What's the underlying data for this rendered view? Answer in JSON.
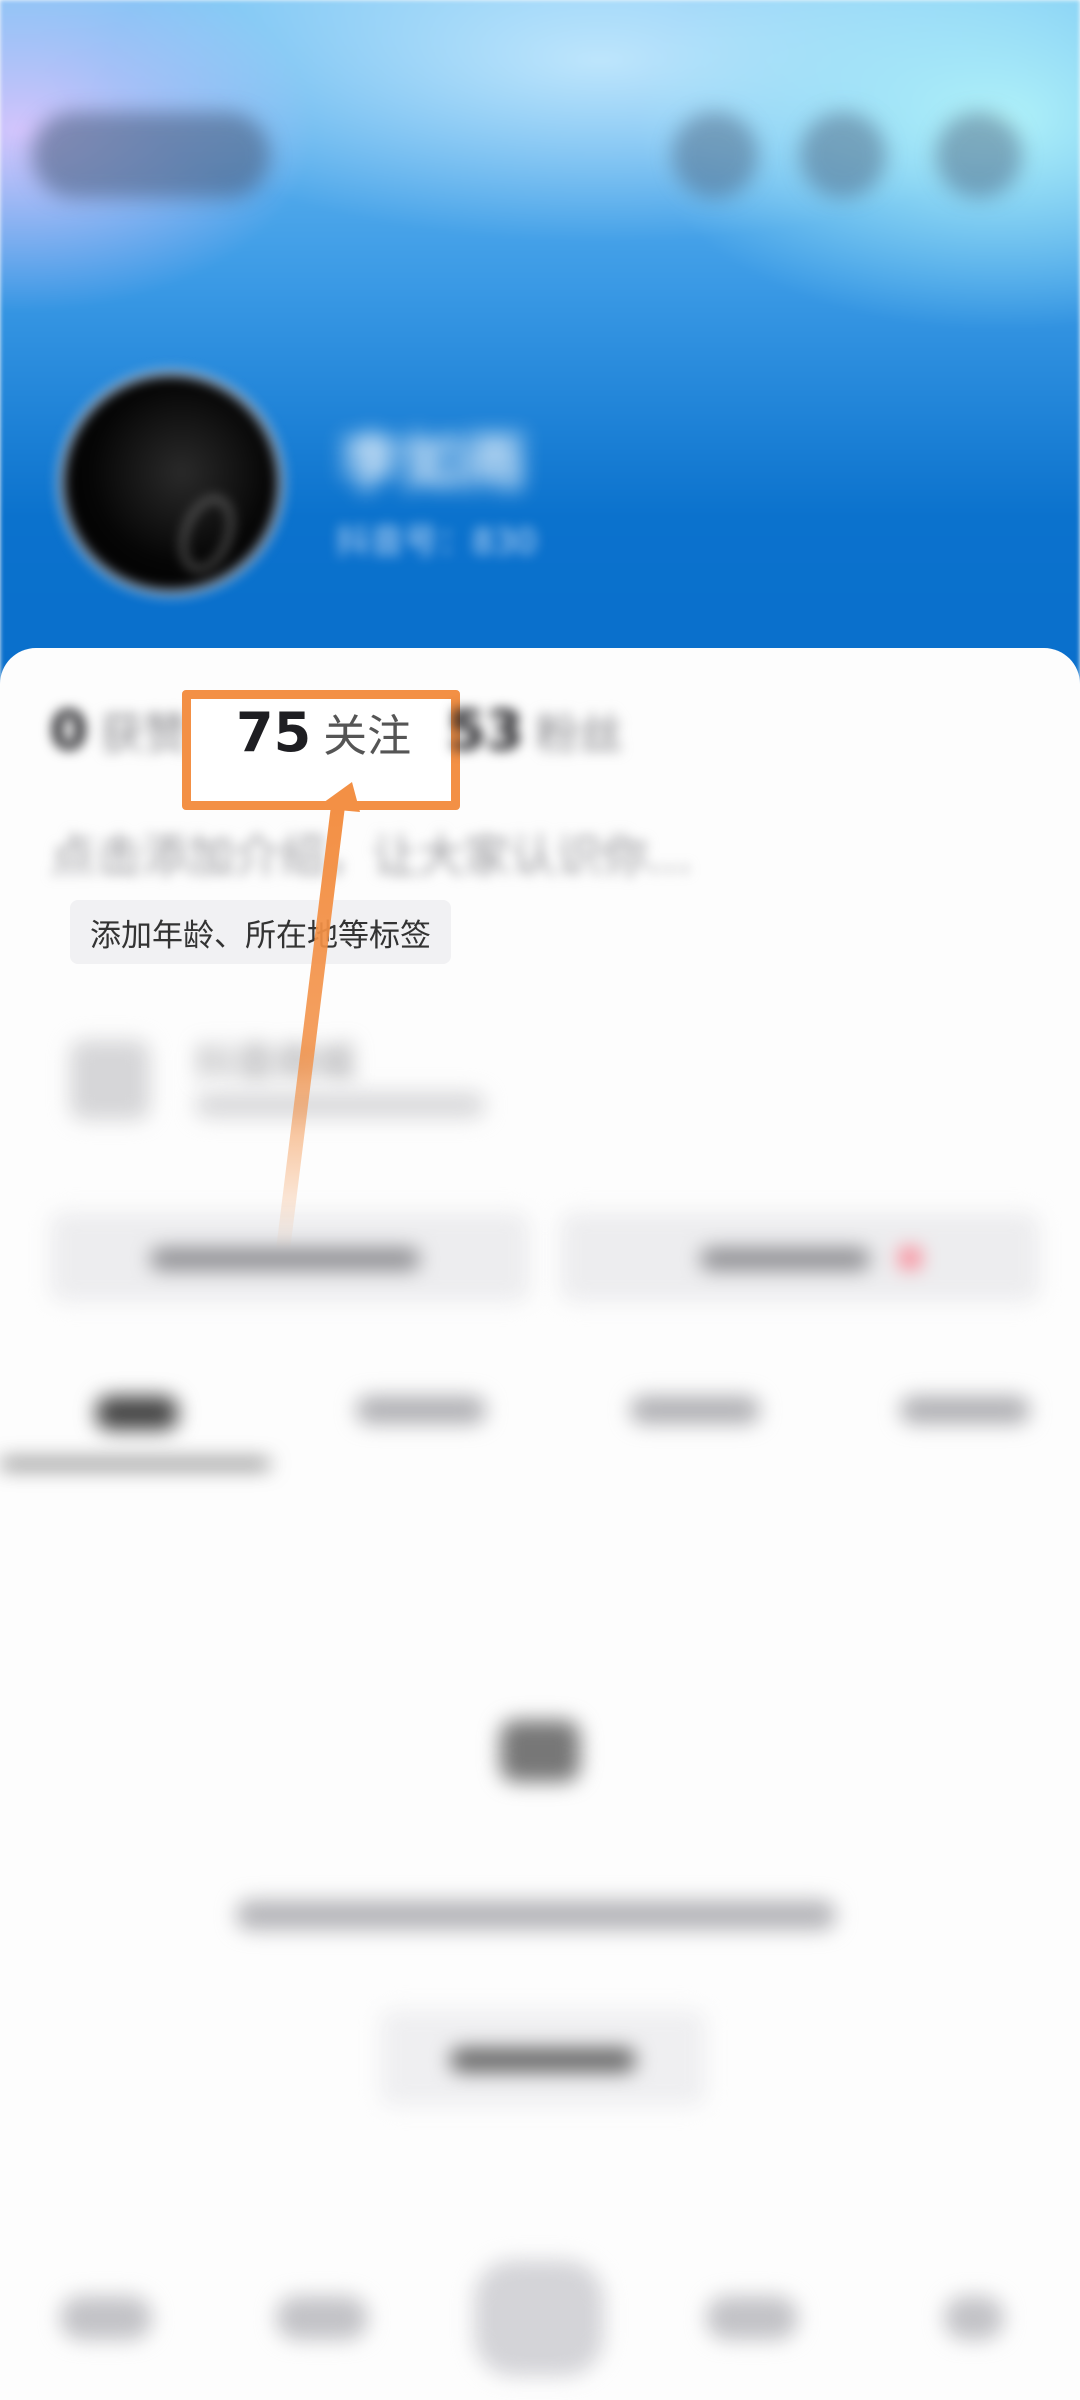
{
  "profile": {
    "username": "李如雨",
    "douyin_id_label": "抖音号：830"
  },
  "stats": {
    "likes": {
      "num": "0",
      "label": "获赞"
    },
    "following": {
      "num": "75",
      "label": "关注"
    },
    "fans": {
      "num": "53",
      "label": "粉丝"
    }
  },
  "intro": {
    "text": "点击添加介绍，让大家认识你..."
  },
  "tags": {
    "chip_text": "添加年龄、所在地等标签"
  },
  "mall": {
    "title": "抖音商城"
  },
  "colors": {
    "highlight_orange": "#f39045",
    "header_blue": "#0a6fcc"
  }
}
